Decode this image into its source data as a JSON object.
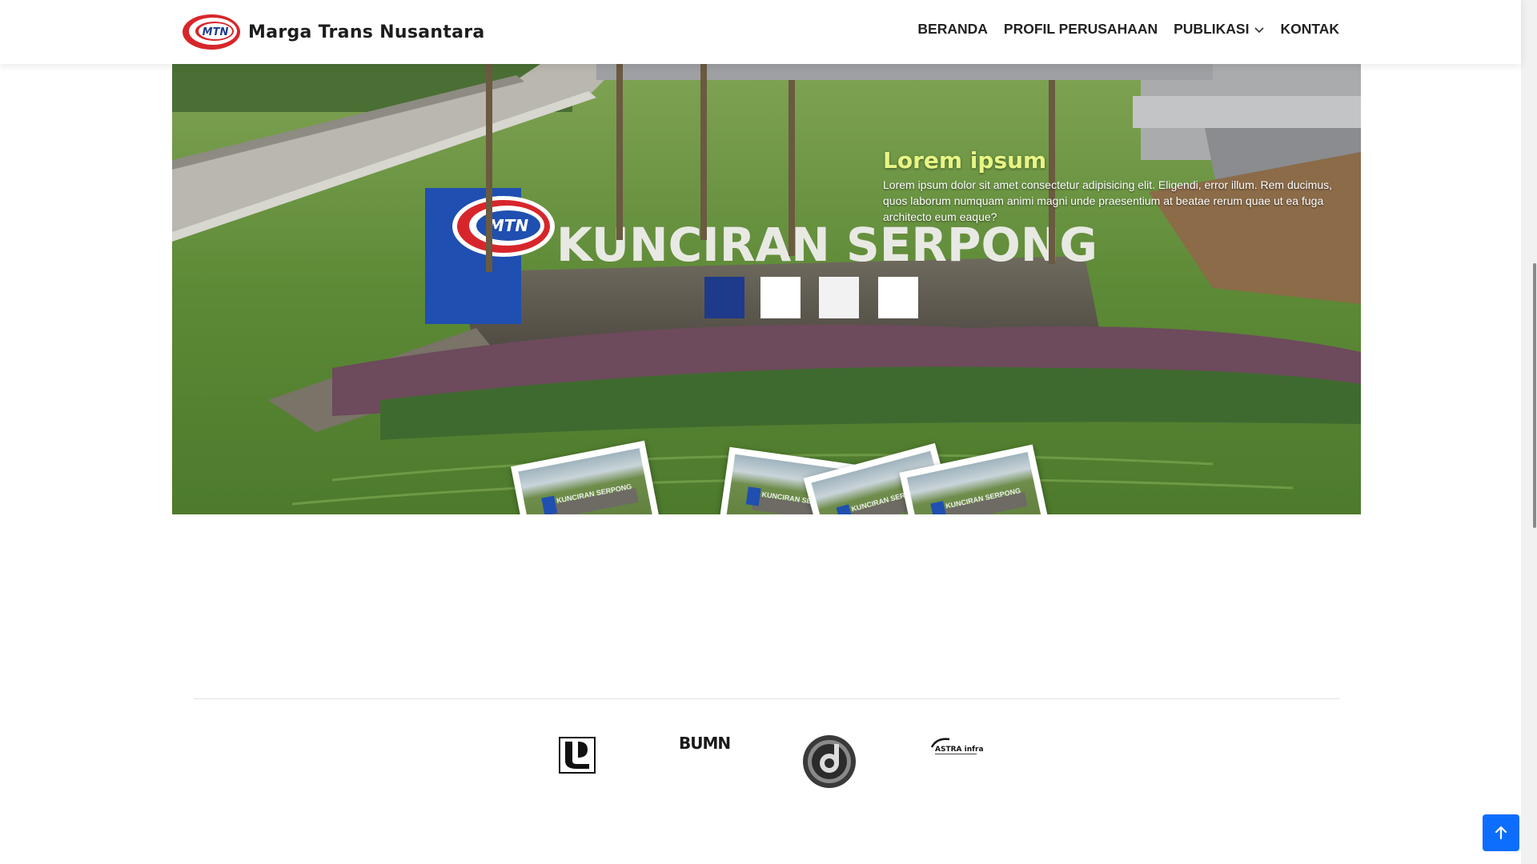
{
  "header": {
    "brand_name": "Marga Trans Nusantara",
    "logo_text": "MTN",
    "nav": [
      {
        "label": "BERANDA"
      },
      {
        "label": "PROFIL PERUSAHAAN"
      },
      {
        "label": "PUBLIKASI",
        "has_dropdown": true
      },
      {
        "label": "KONTAK"
      }
    ]
  },
  "hero": {
    "title": "Lorem ipsum",
    "text": "Lorem ipsum dolor sit amet consectetur adipisicing elit. Eligendi, error illum. Rem ducimus, quos laborum numquam animi magni unde praesentium at beatae rerum quae ut ea fuga architecto eum eaque?",
    "sign_text": "KUNCIRAN SERPONG",
    "sign_logo_text": "MTN",
    "thumbnail_caption": "KUNCIRAN SERPONG"
  },
  "partners": [
    {
      "name": "pupr-logo"
    },
    {
      "name": "bumn-logo",
      "text": "BUMN"
    },
    {
      "name": "jasa-marga-logo"
    },
    {
      "name": "astra-infra-logo",
      "text": "ASTRA infra"
    }
  ],
  "colors": {
    "accent": "#0d6efd",
    "brand_red": "#d7262b",
    "hero_title": "#e7f584"
  },
  "icons": {
    "dropdown": "chevron-down-icon",
    "back_to_top": "arrow-up-icon"
  }
}
